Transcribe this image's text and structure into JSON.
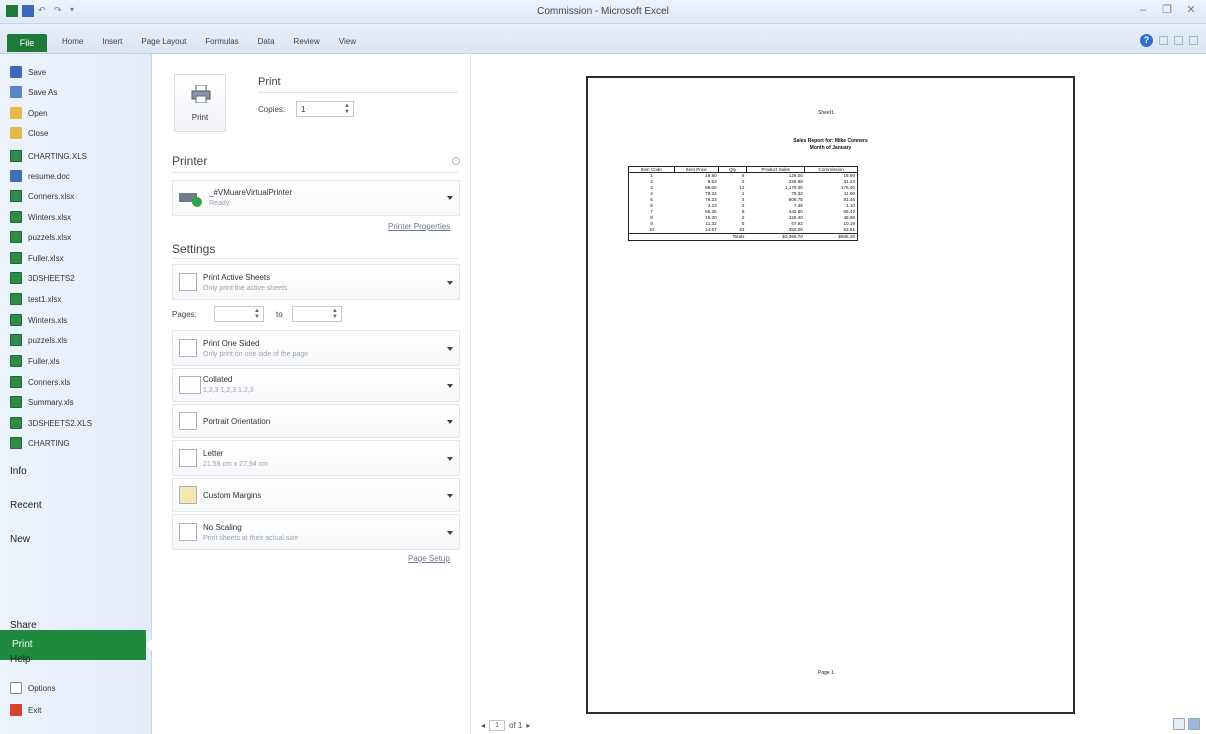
{
  "window": {
    "title": "Commission - Microsoft Excel"
  },
  "ribbon": {
    "file_tab": "File",
    "tabs": [
      "Home",
      "Insert",
      "Page Layout",
      "Formulas",
      "Data",
      "Review",
      "View"
    ]
  },
  "nav": {
    "top_items": [
      {
        "label": "Save",
        "icon": "save-icon"
      },
      {
        "label": "Save As",
        "icon": "save-as-icon"
      },
      {
        "label": "Open",
        "icon": "folder-open-icon"
      },
      {
        "label": "Close",
        "icon": "folder-close-icon"
      }
    ],
    "recent_files": [
      "CHARTING.XLS",
      "resume.doc",
      "Conners.xlsx",
      "Winters.xlsx",
      "puzzels.xlsx",
      "Fuller.xlsx",
      "3DSHEETS2",
      "test1.xlsx",
      "Winters.xls",
      "puzzels.xls",
      "Fuller.xls",
      "Conners.xls",
      "Summary.xls",
      "3DSHEETS2.XLS",
      "CHARTING"
    ],
    "sections": {
      "info": "Info",
      "recent": "Recent",
      "new": "New",
      "print": "Print",
      "share": "Share",
      "help": "Help",
      "options": "Options",
      "exit": "Exit"
    }
  },
  "print_panel": {
    "heading": "Print",
    "print_button": "Print",
    "copies_label": "Copies:",
    "copies_value": "1",
    "printer_title": "Printer",
    "printer_name": "_#VMuareVirtualPrinter",
    "printer_status": "Ready",
    "printer_properties": "Printer Properties",
    "settings_title": "Settings",
    "what_to_print": {
      "main": "Print Active Sheets",
      "sub": "Only print the active sheets"
    },
    "pages_label": "Pages:",
    "to_label": "to",
    "sides": {
      "main": "Print One Sided",
      "sub": "Only print on one side of the page"
    },
    "collation": {
      "main": "Collated",
      "sub": "1,2,3   1,2,3   1,2,3"
    },
    "orientation": {
      "main": "Portrait Orientation"
    },
    "paper": {
      "main": "Letter",
      "sub": "21.59 cm x 27.94 cm"
    },
    "margins": {
      "main": "Custom Margins"
    },
    "scaling": {
      "main": "No Scaling",
      "sub": "Print sheets at their actual size"
    },
    "page_setup": "Page Setup"
  },
  "preview": {
    "header": "Sheet1",
    "report_title": "Sales Report for: Mike Conners",
    "report_subtitle": "Month of January",
    "columns": [
      "Item Code",
      "Item Price",
      "Qty",
      "Product Sales",
      "Commission"
    ],
    "rows": [
      [
        "1",
        "19.80",
        "5",
        "126.00",
        "18.90"
      ],
      [
        "2",
        "8.53",
        "2",
        "226.98",
        "31.34"
      ],
      [
        "3",
        "98.00",
        "12",
        "1,176.00",
        "176.40"
      ],
      [
        "4",
        "79.32",
        "1",
        "79.32",
        "11.90"
      ],
      [
        "5",
        "76.23",
        "4",
        "609.75",
        "91.46"
      ],
      [
        "6",
        "3.23",
        "2",
        "7.36",
        "1.10"
      ],
      [
        "7",
        "55.35",
        "8",
        "442.80",
        "66.42"
      ],
      [
        "8",
        "16.30",
        "2",
        "326.40",
        "48.96"
      ],
      [
        "9",
        "11.32",
        "5",
        "67.92",
        "10.19"
      ],
      [
        "10",
        "14.67",
        "24",
        "352.08",
        "52.81"
      ]
    ],
    "total_label": "Totals",
    "total_sales": "$3,368.70",
    "total_commission": "$505.30",
    "footer": "Page 1",
    "current_page": "1",
    "of_pages": "of 1"
  }
}
